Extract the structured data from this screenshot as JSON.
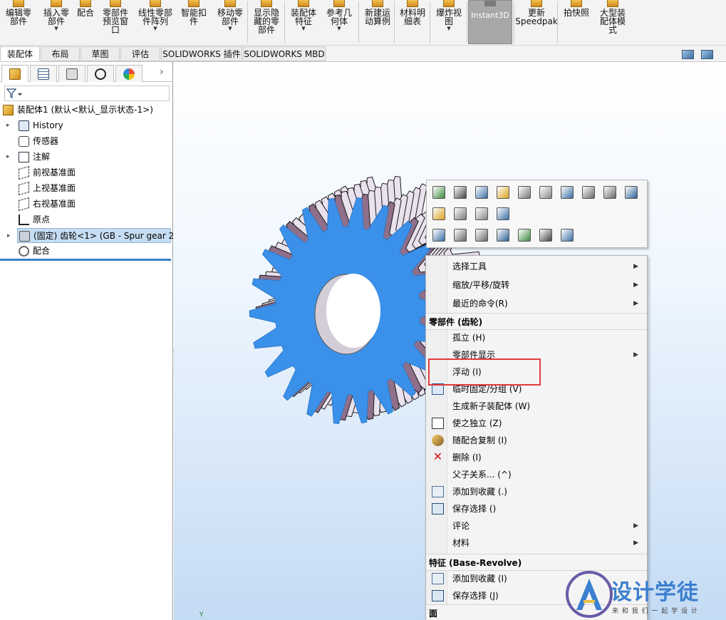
{
  "ribbon": {
    "items": [
      {
        "label": "编辑零\n部件",
        "dropdown": false
      },
      {
        "label": "插入零\n部件",
        "dropdown": true
      },
      {
        "label": "配合",
        "dropdown": false
      },
      {
        "label": "零部件\n预览窗\n口",
        "dropdown": false
      },
      {
        "label": "线性零部\n件阵列",
        "dropdown": true
      },
      {
        "label": "智能扣\n件",
        "dropdown": false
      },
      {
        "label": "移动零\n部件",
        "dropdown": true
      },
      {
        "label": "显示隐\n藏的零\n部件",
        "dropdown": false
      },
      {
        "label": "装配体\n特征",
        "dropdown": true
      },
      {
        "label": "参考几\n何体",
        "dropdown": true
      },
      {
        "label": "新建运\n动算例",
        "dropdown": false
      },
      {
        "label": "材料明\n细表",
        "dropdown": false
      },
      {
        "label": "爆炸视\n图",
        "dropdown": true
      },
      {
        "label": "Instant3D",
        "dropdown": false
      },
      {
        "label": "更新\nSpeedpak",
        "dropdown": false
      },
      {
        "label": "拍快照",
        "dropdown": false
      },
      {
        "label": "大型装\n配体模\n式",
        "dropdown": false
      }
    ]
  },
  "tabs": [
    "装配体",
    "布局",
    "草图",
    "评估",
    "SOLIDWORKS 插件",
    "SOLIDWORKS MBD"
  ],
  "active_tab": "装配体",
  "feature_tree": {
    "root": "装配体1 (默认<默认_显示状态-1>)",
    "items": [
      {
        "label": "History",
        "expandable": true
      },
      {
        "label": "传感器",
        "expandable": false
      },
      {
        "label": "注解",
        "expandable": true
      },
      {
        "label": "前视基准面",
        "expandable": false
      },
      {
        "label": "上视基准面",
        "expandable": false
      },
      {
        "label": "右视基准面",
        "expandable": false
      },
      {
        "label": "原点",
        "expandable": false
      },
      {
        "label": "(固定) 齿轮<1> (GB - Spur gear 2",
        "expandable": true,
        "selected": true
      },
      {
        "label": "配合",
        "expandable": false
      }
    ]
  },
  "viewport": {
    "triad_label": "Y",
    "gear_color": "#3b91ea"
  },
  "context_menu": {
    "items": [
      {
        "label": "选择工具",
        "submenu": true
      },
      {
        "label": "缩放/平移/旋转",
        "submenu": true
      },
      {
        "label": "最近的命令(R)",
        "submenu": true
      }
    ],
    "section1": "零部件 (齿轮)",
    "component_items": [
      {
        "label": "孤立 (H)",
        "submenu": false,
        "icon": ""
      },
      {
        "label": "零部件显示",
        "submenu": true,
        "icon": ""
      },
      {
        "label": "浮动 (I)",
        "submenu": false,
        "icon": ""
      },
      {
        "label": "临时固定/分组 (V)",
        "submenu": false,
        "icon": "lock-group-icon"
      },
      {
        "label": "生成新子装配体 (W)",
        "submenu": false,
        "icon": ""
      },
      {
        "label": "使之独立 (Z)",
        "submenu": false,
        "icon": "independent-icon"
      },
      {
        "label": "随配合复制 (I)",
        "submenu": false,
        "icon": "copy-with-mates-icon"
      },
      {
        "label": "删除 (I)",
        "submenu": false,
        "icon": "delete-icon"
      },
      {
        "label": "父子关系... (^)",
        "submenu": false,
        "icon": ""
      },
      {
        "label": "添加到收藏 (.)",
        "submenu": false,
        "icon": "favorite-icon"
      },
      {
        "label": "保存选择 ()",
        "submenu": false,
        "icon": "save-selection-icon"
      },
      {
        "label": "评论",
        "submenu": true,
        "icon": ""
      },
      {
        "label": "材料",
        "submenu": true,
        "icon": ""
      }
    ],
    "section2": "特征 (Base-Revolve)",
    "feature_items": [
      {
        "label": "添加到收藏 (I)",
        "icon": "favorite-icon"
      },
      {
        "label": "保存选择 (J)",
        "icon": "save-selection-icon"
      }
    ],
    "section3": "面"
  },
  "watermark": {
    "title": "设计学徒",
    "subtitle": "来 和 我 们 一 起 学 设 计"
  },
  "colors": {
    "highlight": "#e23a3a",
    "tree_select": "#c7ddf2",
    "accent": "#3b82c4"
  }
}
